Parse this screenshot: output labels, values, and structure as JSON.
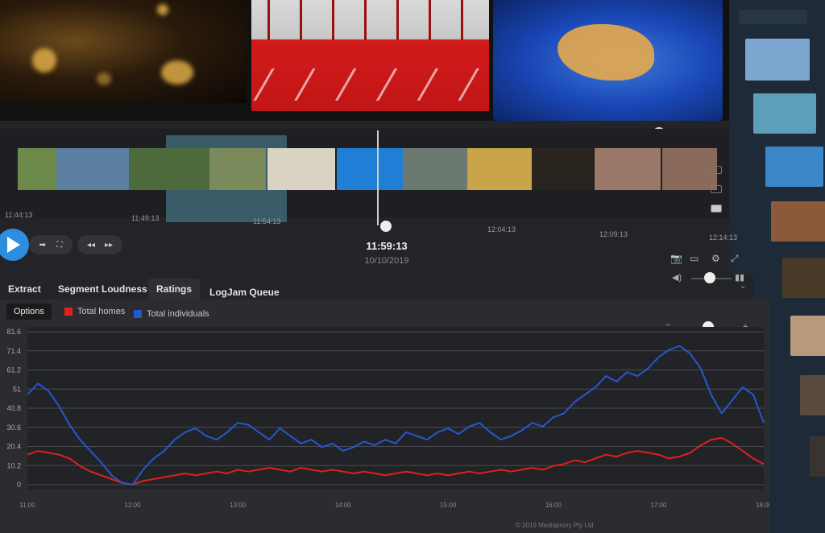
{
  "timeline": {
    "ticks": [
      "11:44:13",
      "11:49:13",
      "11:54:13",
      "12:04:13",
      "12:09:13",
      "12:14:13"
    ],
    "current_time": "11:59:13",
    "current_date": "10/10/2019"
  },
  "transport": {
    "play_icon": "play-icon",
    "step_icon": "step-forward-icon",
    "frame_icon": "frame-icon",
    "prev_icon": "previous-icon",
    "next_icon": "next-icon",
    "screenshot_icon": "camera-icon",
    "cc_icon": "closed-captions-icon",
    "settings_icon": "gear-icon",
    "fullscreen_icon": "fullscreen-icon",
    "volume_icon": "volume-icon",
    "levels_icon": "bar-chart-icon"
  },
  "tabs": [
    {
      "label": "Extract"
    },
    {
      "label": "Segment Loudness"
    },
    {
      "label": "Ratings",
      "active": true
    },
    {
      "label": "LogJam Queue"
    }
  ],
  "ratings": {
    "options_label": "Options",
    "zoom_minus": "−",
    "zoom_plus": "+",
    "zoom_level": 0.62
  },
  "footer": "© 2019 Mediaproxy Pty Ltd",
  "chart_data": {
    "type": "line",
    "title": "",
    "xlabel": "",
    "ylabel": "",
    "x_ticks": [
      "11:00",
      "12:00",
      "13:00",
      "14:00",
      "15:00",
      "16:00",
      "17:00",
      "18:00"
    ],
    "y_ticks": [
      0,
      10.2,
      20.4,
      30.6,
      40.8,
      51,
      61.2,
      71.4,
      81.6
    ],
    "ylim": [
      0,
      81.6
    ],
    "grid": true,
    "legend_placement": "top-left",
    "x_hours": [
      11.0,
      11.1,
      11.2,
      11.3,
      11.4,
      11.5,
      11.6,
      11.7,
      11.8,
      11.9,
      12.0,
      12.1,
      12.2,
      12.3,
      12.4,
      12.5,
      12.6,
      12.7,
      12.8,
      12.9,
      13.0,
      13.1,
      13.2,
      13.3,
      13.4,
      13.5,
      13.6,
      13.7,
      13.8,
      13.9,
      14.0,
      14.1,
      14.2,
      14.3,
      14.4,
      14.5,
      14.6,
      14.7,
      14.8,
      14.9,
      15.0,
      15.1,
      15.2,
      15.3,
      15.4,
      15.5,
      15.6,
      15.7,
      15.8,
      15.9,
      16.0,
      16.1,
      16.2,
      16.3,
      16.4,
      16.5,
      16.6,
      16.7,
      16.8,
      16.9,
      17.0,
      17.1,
      17.2,
      17.3,
      17.4,
      17.5,
      17.6,
      17.7,
      17.8,
      17.9,
      18.0
    ],
    "series": [
      {
        "name": "Total homes",
        "color": "#e0201e",
        "values": [
          16,
          18,
          17,
          16,
          14,
          10,
          7,
          5,
          3,
          1,
          0,
          2,
          3,
          4,
          5,
          6,
          5,
          6,
          7,
          6,
          8,
          7,
          8,
          9,
          8,
          7,
          9,
          8,
          7,
          8,
          7,
          6,
          7,
          6,
          5,
          6,
          7,
          6,
          5,
          6,
          5,
          6,
          7,
          6,
          7,
          8,
          7,
          8,
          9,
          8,
          10,
          11,
          13,
          12,
          14,
          16,
          15,
          17,
          18,
          17,
          16,
          14,
          15,
          17,
          21,
          24,
          25,
          22,
          18,
          14,
          11
        ]
      },
      {
        "name": "Total individuals",
        "color": "#2458d0",
        "values": [
          48,
          54,
          50,
          42,
          32,
          24,
          18,
          12,
          5,
          1,
          0,
          8,
          14,
          18,
          24,
          28,
          30,
          26,
          24,
          28,
          33,
          32,
          28,
          24,
          30,
          26,
          22,
          24,
          20,
          22,
          18,
          20,
          23,
          21,
          24,
          22,
          28,
          26,
          24,
          28,
          30,
          27,
          31,
          33,
          28,
          24,
          26,
          29,
          33,
          31,
          36,
          38,
          44,
          48,
          52,
          58,
          55,
          60,
          58,
          62,
          68,
          72,
          74,
          70,
          62,
          48,
          38,
          45,
          52,
          48,
          33
        ]
      }
    ]
  }
}
